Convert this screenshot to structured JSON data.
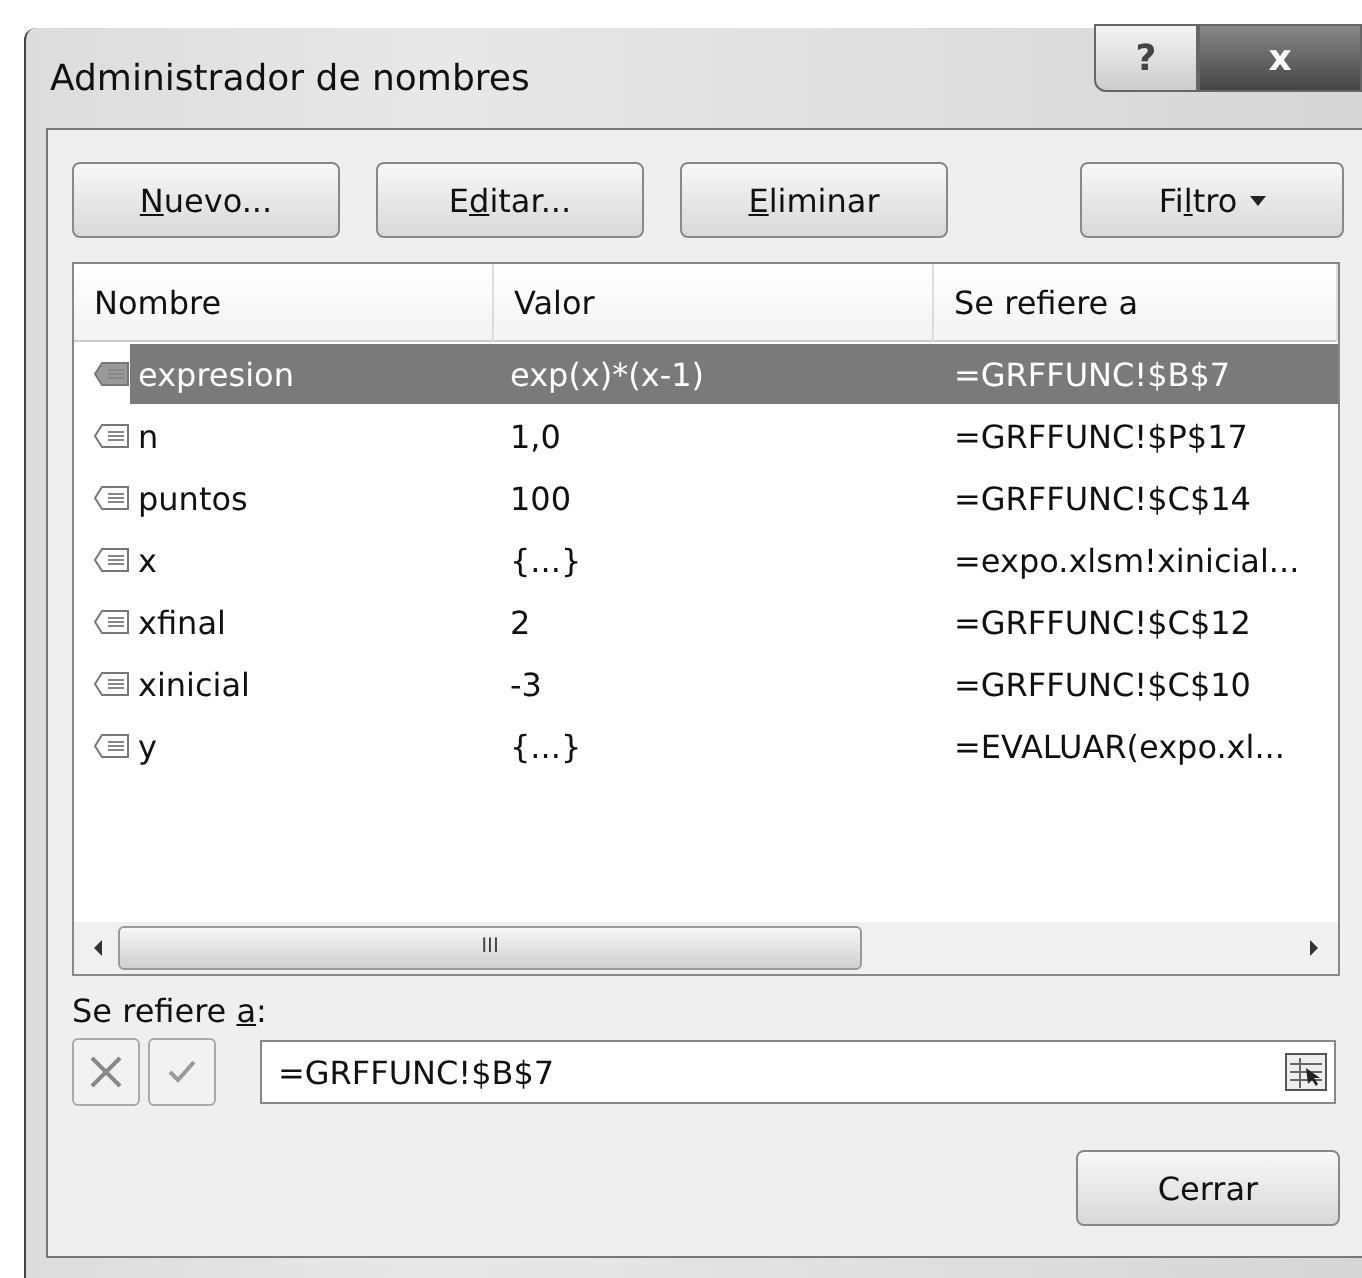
{
  "window": {
    "title": "Administrador de nombres",
    "help_button": "?",
    "close_button": "x"
  },
  "toolbar": [
    {
      "key": "N",
      "suffix": "uevo...",
      "kind": "plain"
    },
    {
      "prefix": "E",
      "key": "d",
      "suffix": "itar...",
      "kind": "plain"
    },
    {
      "key": "E",
      "suffix": "liminar",
      "kind": "plain"
    },
    {
      "prefix": "Fi",
      "key": "l",
      "suffix": "tro",
      "kind": "dropdown"
    }
  ],
  "table": {
    "columns": [
      "Nombre",
      "Valor",
      "Se refiere a"
    ],
    "rows": [
      {
        "name": "expresion",
        "value": "exp(x)*(x-1)",
        "refers_to": "=GRFFUNC!$B$7",
        "selected": true
      },
      {
        "name": "n",
        "value": "1,0",
        "refers_to": "=GRFFUNC!$P$17",
        "selected": false
      },
      {
        "name": "puntos",
        "value": "100",
        "refers_to": "=GRFFUNC!$C$14",
        "selected": false
      },
      {
        "name": "x",
        "value": "{...}",
        "refers_to": "=expo.xlsm!xinicial...",
        "selected": false
      },
      {
        "name": "xfinal",
        "value": "2",
        "refers_to": "=GRFFUNC!$C$12",
        "selected": false
      },
      {
        "name": "xinicial",
        "value": "-3",
        "refers_to": "=GRFFUNC!$C$10",
        "selected": false
      },
      {
        "name": "y",
        "value": "{...}",
        "refers_to": "=EVALUAR(expo.xl...",
        "selected": false
      }
    ],
    "scrollbar_grip": "III"
  },
  "refers_to": {
    "label_prefix": "Se refiere ",
    "label_key": "a",
    "label_suffix": ":",
    "value": "=GRFFUNC!$B$7"
  },
  "footer_button": "Cerrar"
}
